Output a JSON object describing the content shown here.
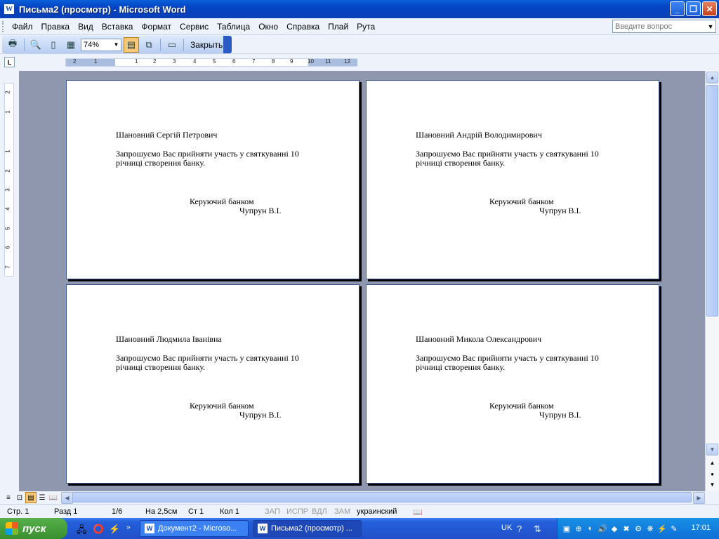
{
  "window": {
    "title": "Письма2 (просмотр) - Microsoft Word",
    "app_icon": "W"
  },
  "menu": [
    "Файл",
    "Правка",
    "Вид",
    "Вставка",
    "Формат",
    "Сервис",
    "Таблица",
    "Окно",
    "Справка",
    "Плай",
    "Рута"
  ],
  "help_box": {
    "placeholder": "Введите вопрос"
  },
  "toolbar": {
    "zoom": "74%",
    "close_label": "Закрыть"
  },
  "ruler": {
    "h_ticks": [
      "2",
      "1",
      "1",
      "2",
      "3",
      "4",
      "5",
      "6",
      "7",
      "8",
      "9",
      "10",
      "11",
      "12"
    ],
    "v_ticks": [
      "2",
      "1",
      "1",
      "2",
      "3",
      "4",
      "5",
      "6",
      "7"
    ]
  },
  "letters": [
    {
      "greeting": "Шановний   Сергій Петрович",
      "body": "Запрошуємо Вас прийняти участь у святкуванні 10 річниці створення банку.",
      "sign_title": "Керуючий банком",
      "sign_name": "Чупрун В.І."
    },
    {
      "greeting": "Шановний   Андрій Володимирович",
      "body": "Запрошуємо Вас прийняти участь у святкуванні 10 річниці створення банку.",
      "sign_title": "Керуючий банком",
      "sign_name": "Чупрун В.І."
    },
    {
      "greeting": "Шановний   Людмила Іванівна",
      "body": "Запрошуємо Вас прийняти участь у святкуванні 10 річниці створення банку.",
      "sign_title": "Керуючий банком",
      "sign_name": "Чупрун В.І."
    },
    {
      "greeting": "Шановний   Микола Олександрович",
      "body": "Запрошуємо Вас прийняти участь у святкуванні 10 річниці створення банку.",
      "sign_title": "Керуючий банком",
      "sign_name": "Чупрун В.І."
    }
  ],
  "status": {
    "page": "Стр. 1",
    "section": "Разд 1",
    "pages": "1/6",
    "at": "На 2,5см",
    "line": "Ст 1",
    "col": "Кол 1",
    "rec": "ЗАП",
    "trk": "ИСПР",
    "ext": "ВДЛ",
    "ovr": "ЗАМ",
    "lang": "украинский"
  },
  "taskbar": {
    "start": "пуск",
    "tasks": [
      "Документ2 - Microso...",
      "Письма2 (просмотр) ..."
    ],
    "lang": "UK",
    "clock": "17:01"
  }
}
